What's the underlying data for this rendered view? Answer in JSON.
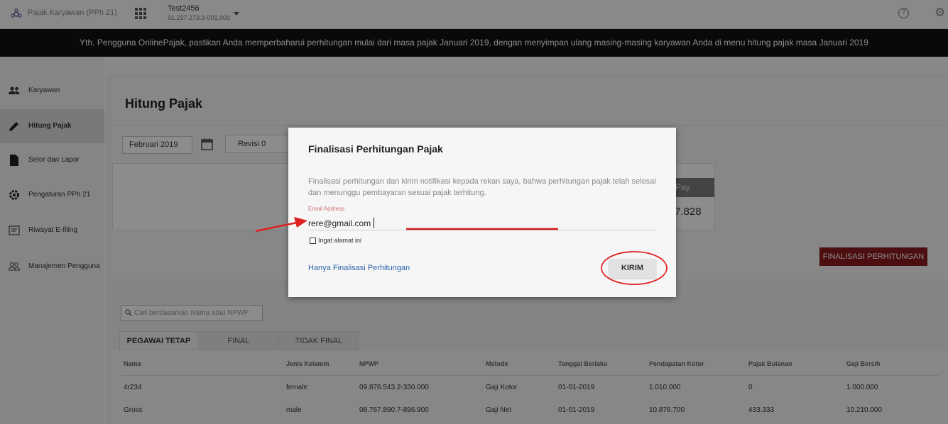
{
  "topbar": {
    "brand": "Pajak Karyawan (PPh 21)",
    "company_name": "Test2456",
    "company_npwp": "91.237.273.9-001.000",
    "help_icon": "?",
    "settings_icon": "⚙"
  },
  "banner": {
    "text": "Yth. Pengguna OnlinePajak, pastikan Anda memperbaharui perhitungan mulai dari masa pajak Januari 2019, dengan menyimpan ulang masing-masing karyawan Anda di menu hitung pajak masa Januari 2019"
  },
  "sidebar": {
    "items": [
      {
        "label": "Karyawan",
        "icon": "people-icon"
      },
      {
        "label": "Hitung Pajak",
        "icon": "pencil-icon"
      },
      {
        "label": "Setor dan Lapor",
        "icon": "document-icon"
      },
      {
        "label": "Pengaturan PPh 21",
        "icon": "gear-icon"
      },
      {
        "label": "Riwayat E-filing",
        "icon": "history-icon"
      },
      {
        "label": "Manajemen Pengguna",
        "icon": "users-icon"
      }
    ]
  },
  "main": {
    "title": "Hitung Pajak",
    "period": "Februari 2019",
    "revision": "Revisi 0",
    "pay_label": "Pay",
    "pay_value": "7.828",
    "finalize_button": "FINALISASI PERHITUNGAN",
    "search_placeholder": "Cari berdasarkan Nama atau NPWP",
    "tabs": [
      "PEGAWAI TETAP",
      "FINAL",
      "TIDAK FINAL"
    ],
    "table": {
      "headers": [
        "Nama",
        "Jenis Kelamin",
        "NPWP",
        "Metode",
        "Tanggal Berlaku",
        "Pendapatan Kotor",
        "Pajak Bulanan",
        "Gaji Bersih"
      ],
      "rows": [
        [
          "4r234",
          "female",
          "09.876.543.2-330.000",
          "Gaji Kotor",
          "01-01-2019",
          "1.010.000",
          "0",
          "1.000.000"
        ],
        [
          "Gross",
          "male",
          "08.767.890.7-896.900",
          "Gaji Net",
          "01-01-2019",
          "10.876.700",
          "433.333",
          "10.210.000"
        ]
      ]
    }
  },
  "modal": {
    "title": "Finalisasi Perhitungan Pajak",
    "description": "Finalisasi perhitungan dan kirim notifikasi kepada rekan saya, bahwa perhitungan pajak telah selesai dan menunggu pembayaran sesuai pajak terhitung.",
    "email_label": "Email Address",
    "email_value": "rere@gmail.com",
    "remember_label": "Ingat alamat ini",
    "only_finalize_link": "Hanya Finalisasi Perhitungan",
    "send_button": "KIRIM"
  },
  "colors": {
    "banner_bg": "#111111",
    "primary_button": "#8b1a1a",
    "link": "#2a63a8",
    "annotation": "#e02020"
  }
}
